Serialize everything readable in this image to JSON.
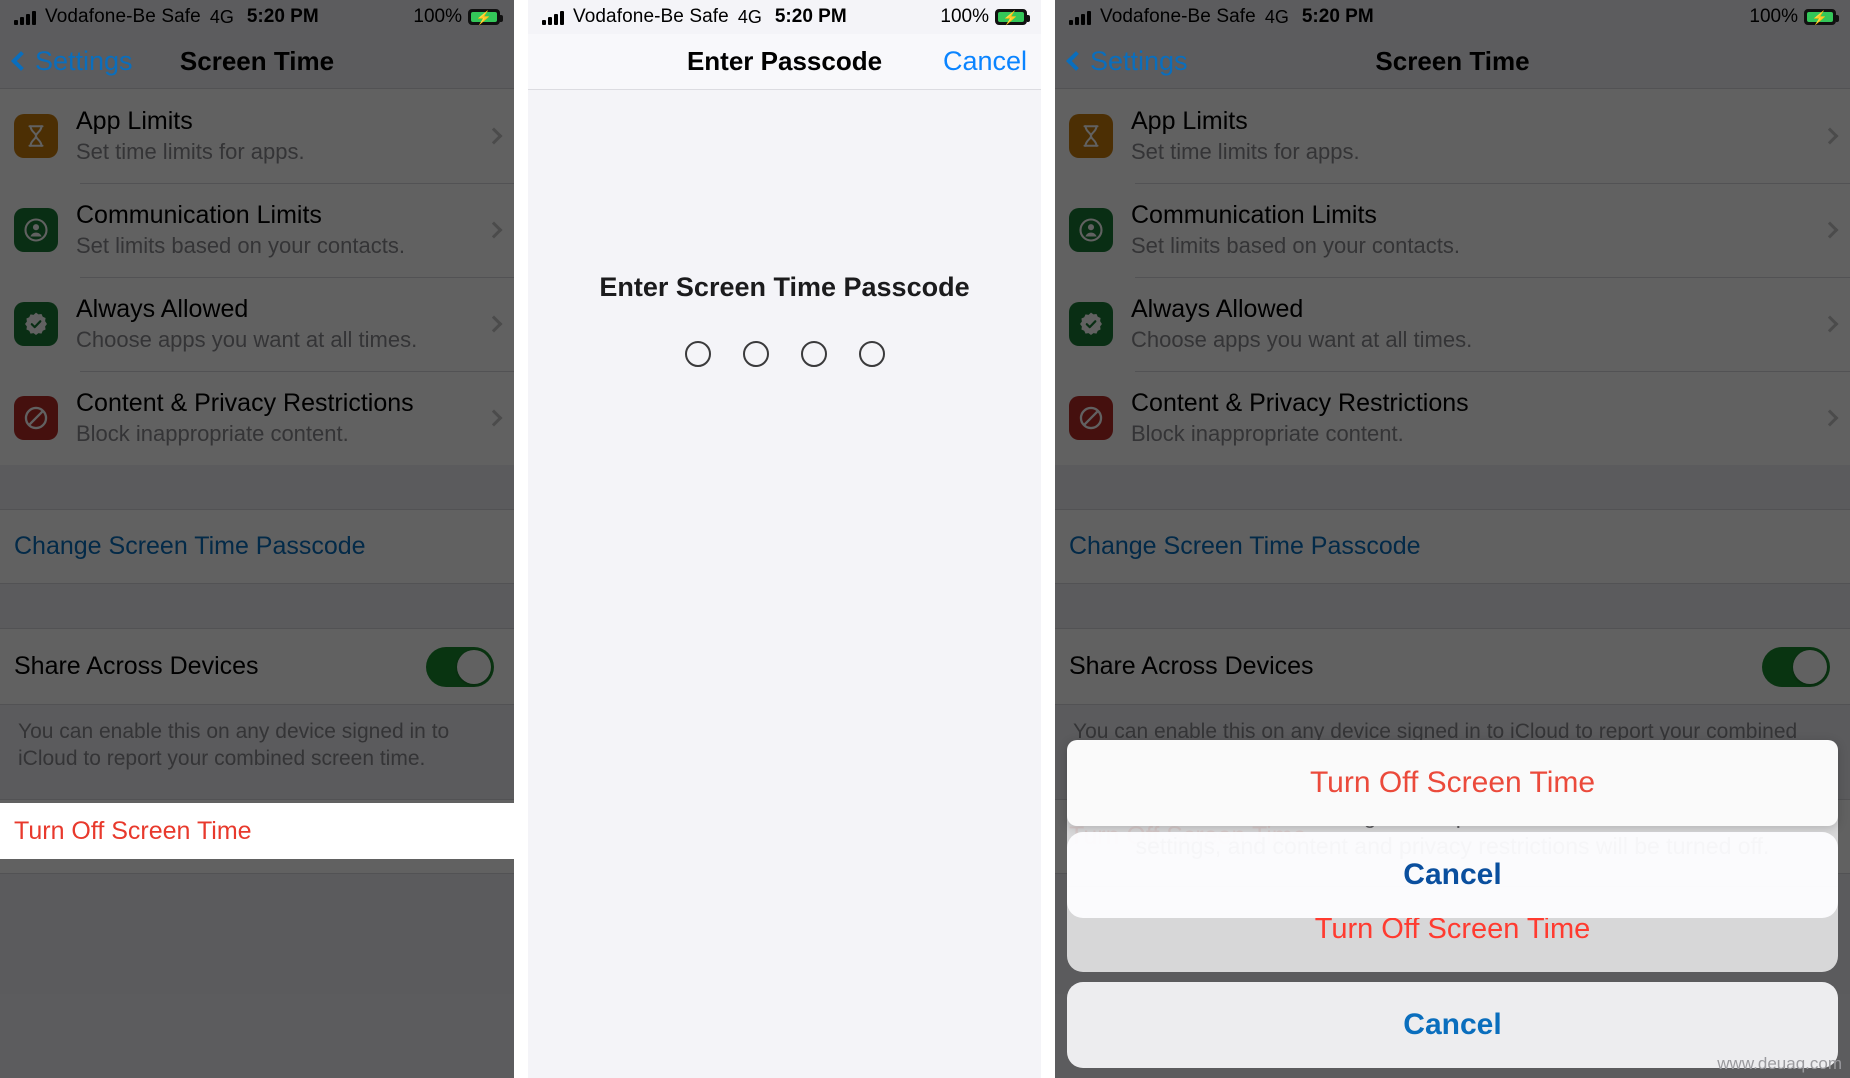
{
  "status_bar": {
    "carrier": "Vodafone-Be Safe",
    "network": "4G",
    "time": "5:20 PM",
    "battery_percent": "100%",
    "battery_icon": "battery-charging-icon",
    "signal_icon": "signal-bars-icon"
  },
  "colors": {
    "accent_blue": "#0a6ebd",
    "destructive_red": "#e8392c",
    "toggle_green": "#1a8a2e",
    "battery_green": "#34c759",
    "icon_orange": "#c77b0d",
    "icon_green": "#1a7a36",
    "icon_red": "#b52a26",
    "list_background": "#ffffff",
    "group_background": "#efeff4"
  },
  "screen_time": {
    "nav": {
      "back_label": "Settings",
      "title": "Screen Time"
    },
    "items": [
      {
        "title": "App Limits",
        "subtitle": "Set time limits for apps.",
        "icon": "hourglass-icon",
        "icon_color": "#c77b0d"
      },
      {
        "title": "Communication Limits",
        "subtitle": "Set limits based on your contacts.",
        "icon": "person-circle-icon",
        "icon_color": "#1a7a36"
      },
      {
        "title": "Always Allowed",
        "subtitle": "Choose apps you want at all times.",
        "icon": "checkmark-seal-icon",
        "icon_color": "#1a7a36"
      },
      {
        "title": "Content & Privacy Restrictions",
        "subtitle": "Block inappropriate content.",
        "icon": "no-entry-icon",
        "icon_color": "#b52a26"
      }
    ],
    "change_passcode_label": "Change Screen Time Passcode",
    "share_across_devices": {
      "label": "Share Across Devices",
      "enabled": true,
      "footnote": "You can enable this on any device signed in to iCloud to report your combined screen time."
    },
    "turn_off_label": "Turn Off Screen Time"
  },
  "passcode_screen": {
    "nav": {
      "title": "Enter Passcode",
      "cancel_label": "Cancel"
    },
    "prompt": "Enter Screen Time Passcode",
    "digit_count": 4,
    "digits_entered": 0
  },
  "action_sheet": {
    "message": "Screen time will no longer be reported, and all limits, downtime settings, and content and privacy restrictions will be turned off.",
    "destructive_label": "Turn Off Screen Time",
    "cancel_label": "Cancel"
  },
  "watermark": "www.deuaq.com"
}
